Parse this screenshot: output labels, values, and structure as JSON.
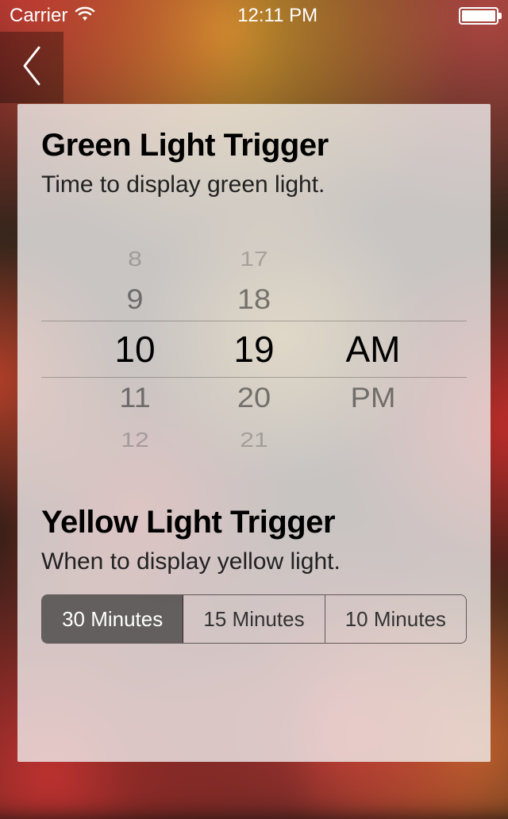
{
  "status": {
    "carrier": "Carrier",
    "time": "12:11 PM"
  },
  "sections": {
    "green": {
      "title": "Green Light Trigger",
      "subtitle": "Time to display green light."
    },
    "yellow": {
      "title": "Yellow Light Trigger",
      "subtitle": "When to display yellow light."
    }
  },
  "picker": {
    "hours": [
      "8",
      "9",
      "10",
      "11",
      "12"
    ],
    "minutes": [
      "17",
      "18",
      "19",
      "20",
      "21"
    ],
    "ampm": [
      "AM",
      "PM"
    ],
    "selected": {
      "hour": "10",
      "minute": "19",
      "ampm": "AM"
    }
  },
  "segments": {
    "options": [
      "30 Minutes",
      "15 Minutes",
      "10 Minutes"
    ],
    "selected_index": 0
  }
}
